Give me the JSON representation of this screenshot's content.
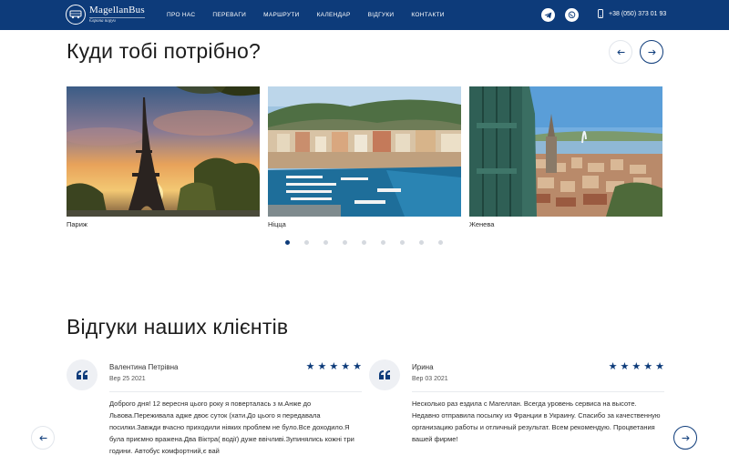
{
  "header": {
    "logo_name": "MagellanBus",
    "logo_tag": "Європа поруч",
    "nav": [
      "ПРО НАС",
      "ПЕРЕВАГИ",
      "МАРШРУТИ",
      "КАЛЕНДАР",
      "ВІДГУКИ",
      "КОНТАКТИ"
    ],
    "phone": "+38 (050) 373 01 93",
    "icons": [
      "telegram-icon",
      "viber-icon",
      "phone-icon"
    ]
  },
  "destinations": {
    "title": "Куди тобі потрібно?",
    "cards": [
      {
        "label": "Париж"
      },
      {
        "label": "Ніцца"
      },
      {
        "label": "Женева"
      }
    ],
    "pager_count": 9,
    "pager_active": 0
  },
  "reviews": {
    "title": "Відгуки наших клієнтів",
    "items": [
      {
        "name": "Валентина Петрівна",
        "date": "Вер 25 2021",
        "stars": 5,
        "text": "Доброго дня! 12 вересня цього року я поверталась з м.Анже до Львова.Переживала адже двоє суток (хати.До цього я передавала посилки.Завжди вчасно приходили ніяких проблем не було.Все доходило.Я була приємно вражена.Два Віктра( водії) дуже ввічливі.Зупинялись кожні три години. Автобус комфортний,є вай"
      },
      {
        "name": "Ирина",
        "date": "Вер 03 2021",
        "stars": 5,
        "text": "Несколько раз ездила с Магеллан. Всегда уровень сервиса на высоте. Недавно отправила посылку из Франции в Украину. Спасибо за качественную организацию работы и отличный результат. Всем рекомендую. Процветания вашей фирме!"
      }
    ]
  },
  "colors": {
    "primary": "#0d3b7a",
    "light_border": "#e2e6ec",
    "quote_bg": "#eef0f4"
  }
}
